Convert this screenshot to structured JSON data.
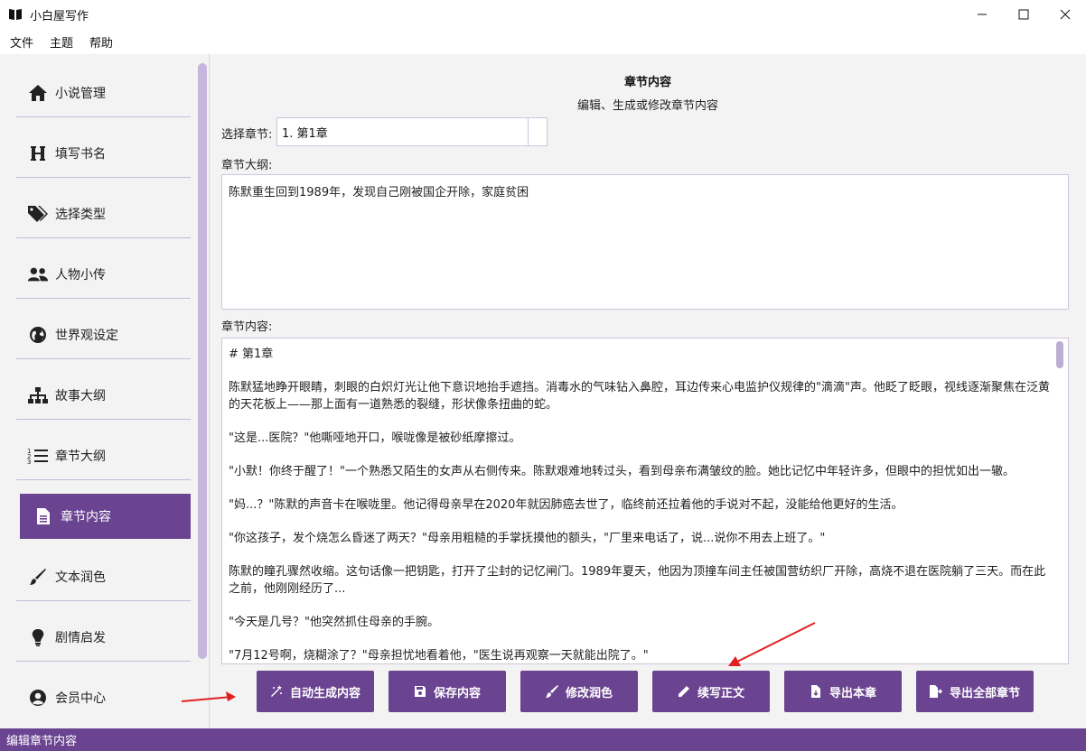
{
  "window": {
    "title": "小白屋写作",
    "minimize": "—",
    "maximize": "☐",
    "close": "✕"
  },
  "menu": [
    "文件",
    "主题",
    "帮助"
  ],
  "sidebar": {
    "items": [
      {
        "label": "小说管理",
        "icon": "home-icon"
      },
      {
        "label": "填写书名",
        "icon": "heading-icon"
      },
      {
        "label": "选择类型",
        "icon": "tags-icon"
      },
      {
        "label": "人物小传",
        "icon": "users-icon"
      },
      {
        "label": "世界观设定",
        "icon": "globe-icon"
      },
      {
        "label": "故事大纲",
        "icon": "sitemap-icon"
      },
      {
        "label": "章节大纲",
        "icon": "list-ol-icon"
      },
      {
        "label": "章节内容",
        "icon": "file-icon",
        "active": true
      },
      {
        "label": "文本润色",
        "icon": "brush-icon"
      },
      {
        "label": "剧情启发",
        "icon": "lightbulb-icon"
      },
      {
        "label": "会员中心",
        "icon": "user-circle-icon"
      }
    ]
  },
  "main": {
    "title": "章节内容",
    "subtitle": "编辑、生成或修改章节内容",
    "chapter_select_label": "选择章节:",
    "chapter_select_value": "1. 第1章",
    "outline_label": "章节大纲:",
    "outline_text": "陈默重生回到1989年，发现自己刚被国企开除，家庭贫困",
    "content_label": "章节内容:",
    "content_paragraphs": [
      "# 第1章",
      "陈默猛地睁开眼睛，刺眼的白炽灯光让他下意识地抬手遮挡。消毒水的气味钻入鼻腔，耳边传来心电监护仪规律的\"滴滴\"声。他眨了眨眼，视线逐渐聚焦在泛黄的天花板上——那上面有一道熟悉的裂缝，形状像条扭曲的蛇。",
      "\"这是...医院？\"他嘶哑地开口，喉咙像是被砂纸摩擦过。",
      "\"小默！你终于醒了！\"一个熟悉又陌生的女声从右侧传来。陈默艰难地转过头，看到母亲布满皱纹的脸。她比记忆中年轻许多，但眼中的担忧如出一辙。",
      "\"妈...？\"陈默的声音卡在喉咙里。他记得母亲早在2020年就因肺癌去世了，临终前还拉着他的手说对不起，没能给他更好的生活。",
      "\"你这孩子，发个烧怎么昏迷了两天？\"母亲用粗糙的手掌抚摸他的额头，\"厂里来电话了，说...说你不用去上班了。\"",
      "陈默的瞳孔骤然收缩。这句话像一把钥匙，打开了尘封的记忆闸门。1989年夏天，他因为顶撞车间主任被国营纺织厂开除，高烧不退在医院躺了三天。而在此之前，他刚刚经历了...",
      "\"今天是几号？\"他突然抓住母亲的手腕。",
      "\"7月12号啊，烧糊涂了？\"母亲担忧地看着他，\"医生说再观察一天就能出院了。\""
    ],
    "buttons": [
      {
        "label": "自动生成内容",
        "icon": "magic-icon"
      },
      {
        "label": "保存内容",
        "icon": "save-icon"
      },
      {
        "label": "修改润色",
        "icon": "brush-icon"
      },
      {
        "label": "续写正文",
        "icon": "pen-icon"
      },
      {
        "label": "导出本章",
        "icon": "file-export-icon"
      },
      {
        "label": "导出全部章节",
        "icon": "export-all-icon"
      }
    ]
  },
  "status": {
    "text": "编辑章节内容"
  },
  "colors": {
    "accent": "#6a4491",
    "arrow": "#e02020"
  }
}
